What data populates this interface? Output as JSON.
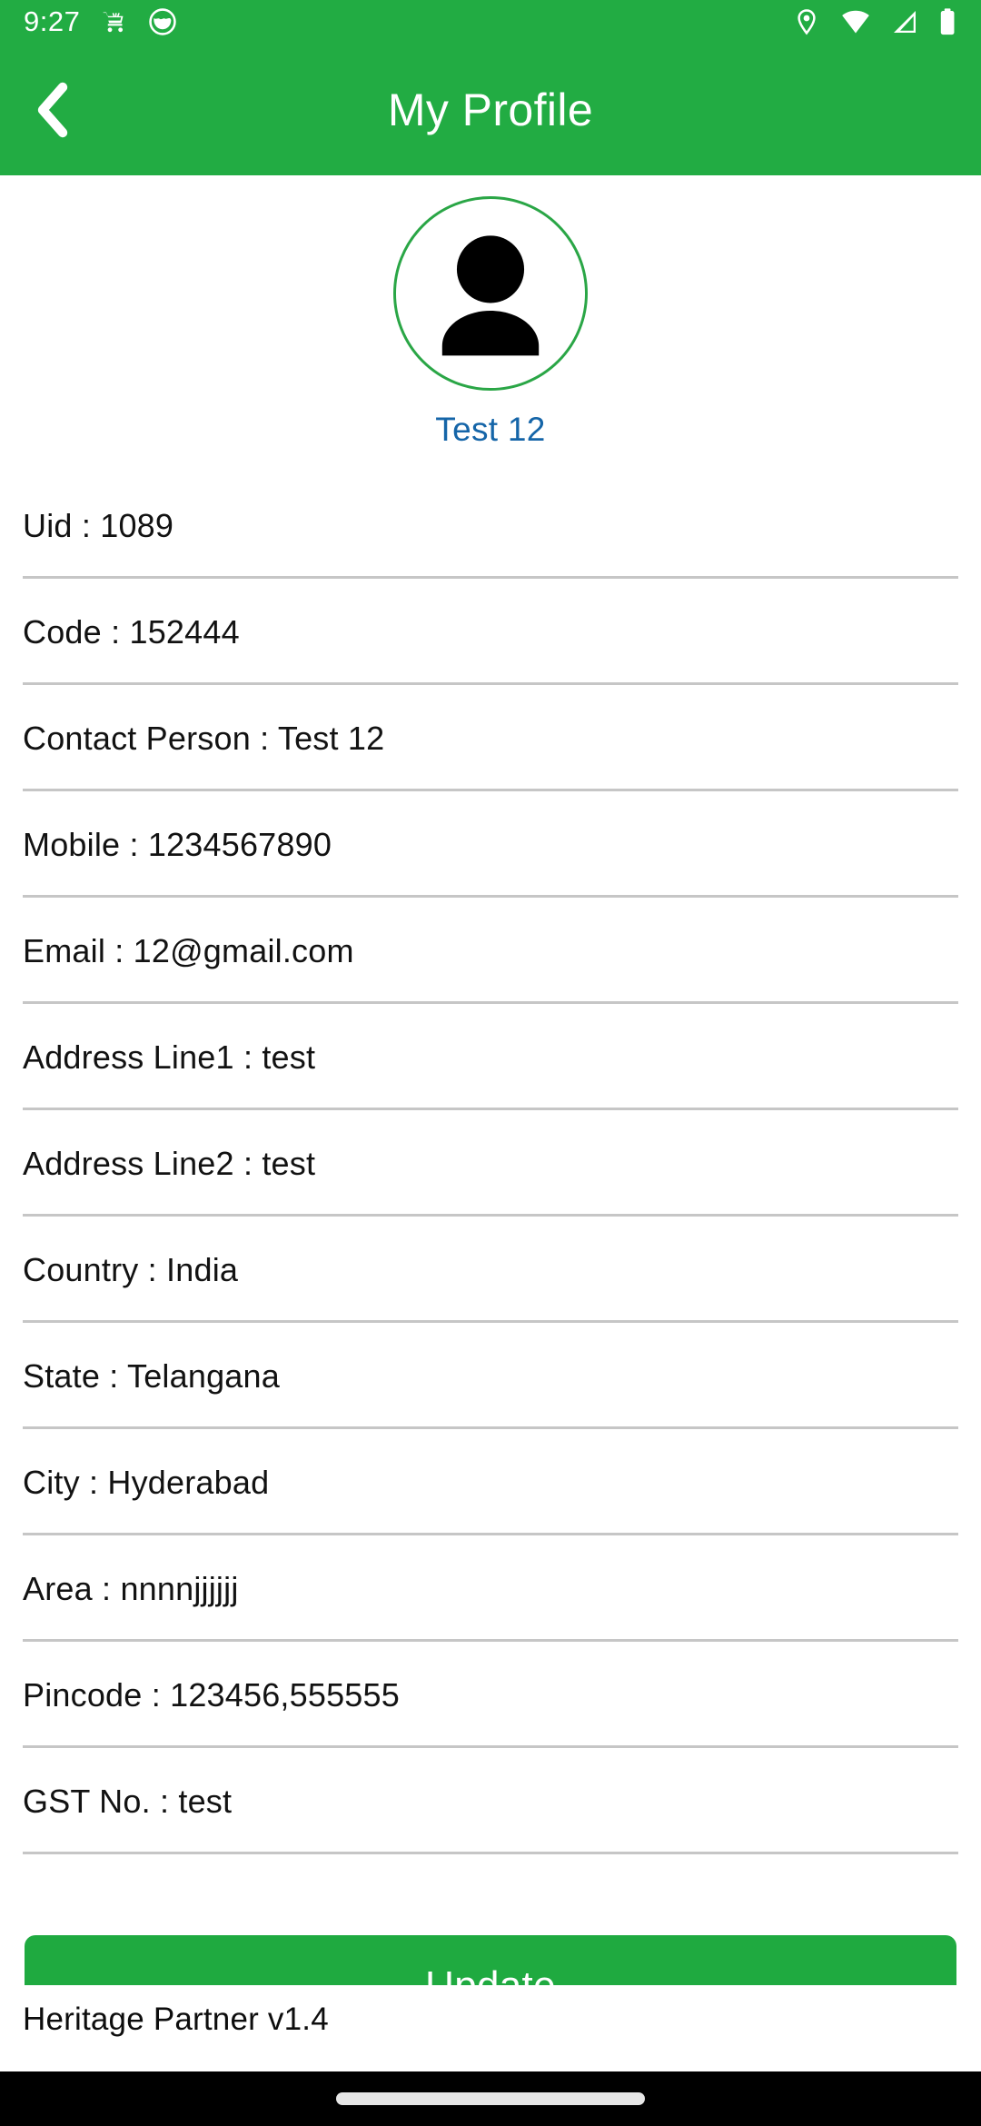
{
  "status_bar": {
    "time": "9:27",
    "left_icons": [
      "shopping-cart-icon",
      "face-circle-icon"
    ],
    "right_icons": [
      "location-pin-icon",
      "wifi-icon",
      "cellular-signal-icon",
      "battery-icon"
    ]
  },
  "app_bar": {
    "title": "My Profile",
    "back_icon": "chevron-left-icon",
    "background_color": "#22ac43"
  },
  "profile": {
    "avatar_icon": "person-avatar-icon",
    "name": "Test 12",
    "name_color": "#1565a8",
    "ring_color": "#2aa646"
  },
  "fields": [
    {
      "label": "Uid",
      "value": "1089",
      "text": "Uid : 1089"
    },
    {
      "label": "Code",
      "value": "152444",
      "text": "Code : 152444"
    },
    {
      "label": "Contact Person",
      "value": "Test 12",
      "text": "Contact Person : Test 12"
    },
    {
      "label": "Mobile",
      "value": "1234567890",
      "text": "Mobile : 1234567890"
    },
    {
      "label": "Email",
      "value": "12@gmail.com",
      "text": "Email : 12@gmail.com"
    },
    {
      "label": "Address Line1",
      "value": "test",
      "text": "Address Line1 : test"
    },
    {
      "label": "Address Line2",
      "value": "test",
      "text": "Address Line2 : test"
    },
    {
      "label": "Country",
      "value": "India",
      "text": "Country : India"
    },
    {
      "label": "State",
      "value": "Telangana",
      "text": "State : Telangana"
    },
    {
      "label": "City",
      "value": "Hyderabad",
      "text": "City : Hyderabad"
    },
    {
      "label": "Area",
      "value": "nnnnjjjjjj",
      "text": "Area : nnnnjjjjjj"
    },
    {
      "label": "Pincode",
      "value": "123456,555555",
      "text": "Pincode : 123456,555555"
    },
    {
      "label": "GST No.",
      "value": "test",
      "text": "GST No. : test"
    }
  ],
  "actions": {
    "update_label": "Update",
    "update_color": "#1faa40"
  },
  "footer": {
    "app_version_text": "Heritage Partner v1.4"
  },
  "navigation_bar": {
    "home_indicator": "home-indicator-pill"
  }
}
